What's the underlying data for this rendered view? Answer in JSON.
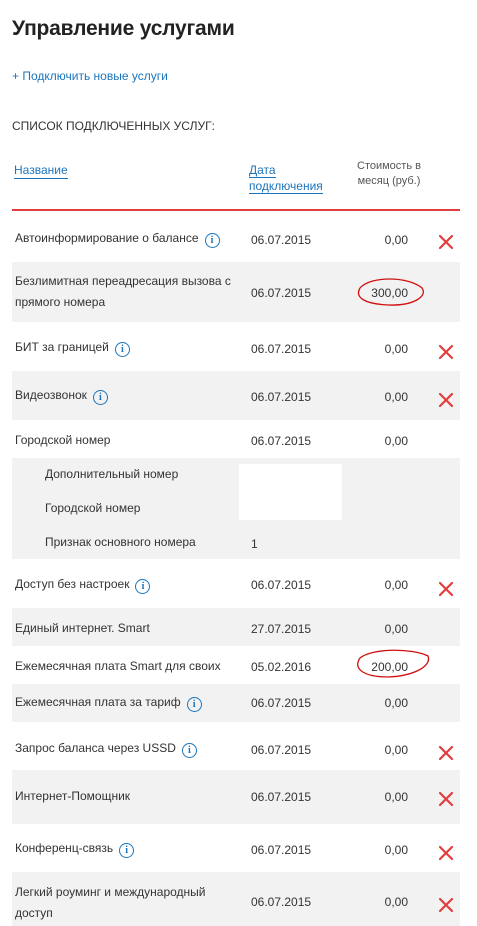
{
  "page": {
    "title": "Управление услугами",
    "add_link": "+ Подключить новые услуги",
    "list_heading": "СПИСОК ПОДКЛЮЧЕННЫХ УСЛУГ:"
  },
  "table": {
    "headers": {
      "name": "Название",
      "date": "Дата подключения",
      "cost_line1": "Стоимость в",
      "cost_line2": "месяц (руб.)"
    },
    "rows": [
      {
        "name": "Автоинформирование о балансе",
        "date": "06.07.2015",
        "cost": "0,00"
      },
      {
        "name_line1": "Безлимитная переадресация вызова с",
        "name_line2": "прямого номера",
        "date": "06.07.2015",
        "cost": "300,00"
      },
      {
        "name": "БИТ за границей",
        "date": "06.07.2015",
        "cost": "0,00"
      },
      {
        "name": "Видеозвонок",
        "date": "06.07.2015",
        "cost": "0,00"
      },
      {
        "name": "Городской номер",
        "date": "06.07.2015",
        "cost": "0,00"
      },
      {
        "name": "Дополнительный номер"
      },
      {
        "name": "Городской номер"
      },
      {
        "name": "Признак основного номера",
        "value": "1"
      },
      {
        "name": "Доступ без настроек",
        "date": "06.07.2015",
        "cost": "0,00"
      },
      {
        "name": "Единый интернет. Smart",
        "date": "27.07.2015",
        "cost": "0,00"
      },
      {
        "name": "Ежемесячная плата Smart для своих",
        "date": "05.02.2016",
        "cost": "200,00"
      },
      {
        "name": "Ежемесячная плата за тариф",
        "date": "06.07.2015",
        "cost": "0,00"
      },
      {
        "name": "Запрос баланса через USSD",
        "date": "06.07.2015",
        "cost": "0,00"
      },
      {
        "name": "Интернет-Помощник",
        "date": "06.07.2015",
        "cost": "0,00"
      },
      {
        "name": "Конференц-связь",
        "date": "06.07.2015",
        "cost": "0,00"
      },
      {
        "name_line1": "Легкий роуминг и международный",
        "name_line2": "доступ",
        "date": "06.07.2015",
        "cost": "0,00"
      }
    ]
  },
  "icons": {
    "info": "info-icon",
    "delete": "delete-icon"
  },
  "colors": {
    "link": "#1b75bc",
    "accent_red": "#e23c3c",
    "row_shade": "#f2f2f2"
  }
}
